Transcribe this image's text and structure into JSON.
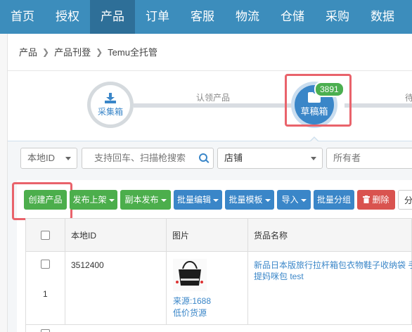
{
  "nav": {
    "items": [
      "首页",
      "授权",
      "产品",
      "订单",
      "客服",
      "物流",
      "仓储",
      "采购",
      "数据"
    ],
    "active_index": 2
  },
  "breadcrumb": [
    "产品",
    "产品刊登",
    "Temu全托管"
  ],
  "steps": {
    "step1_label": "采集箱",
    "connector1_label": "认领产品",
    "step2_label": "草稿箱",
    "step2_badge": "3891",
    "connector2_label": "待"
  },
  "filters": {
    "local_id": "本地ID",
    "search_placeholder": "支持回车、扫描枪搜索",
    "shop": "店铺",
    "owner": "所有者"
  },
  "toolbar": {
    "create": "创建产品",
    "publish": "发布上架",
    "copy_publish": "副本发布",
    "batch_edit": "批量编辑",
    "batch_template": "批量模板",
    "import": "导入",
    "batch_group": "批量分组",
    "delete": "删除",
    "more": "分"
  },
  "table": {
    "headers": [
      "本地ID",
      "图片",
      "货品名称"
    ],
    "rows": [
      {
        "index": "1",
        "local_id": "3512400",
        "source": "来源:1688",
        "source2": "低价货源",
        "name": "新品日本版旅行拉杆箱包衣物鞋子收纳袋 手提妈咪包 test"
      }
    ]
  },
  "colors": {
    "nav_bg": "#3c8dbc",
    "accent": "#3a86c8",
    "green": "#4cae4c",
    "red": "#d9534f",
    "highlight": "#e9636b"
  }
}
